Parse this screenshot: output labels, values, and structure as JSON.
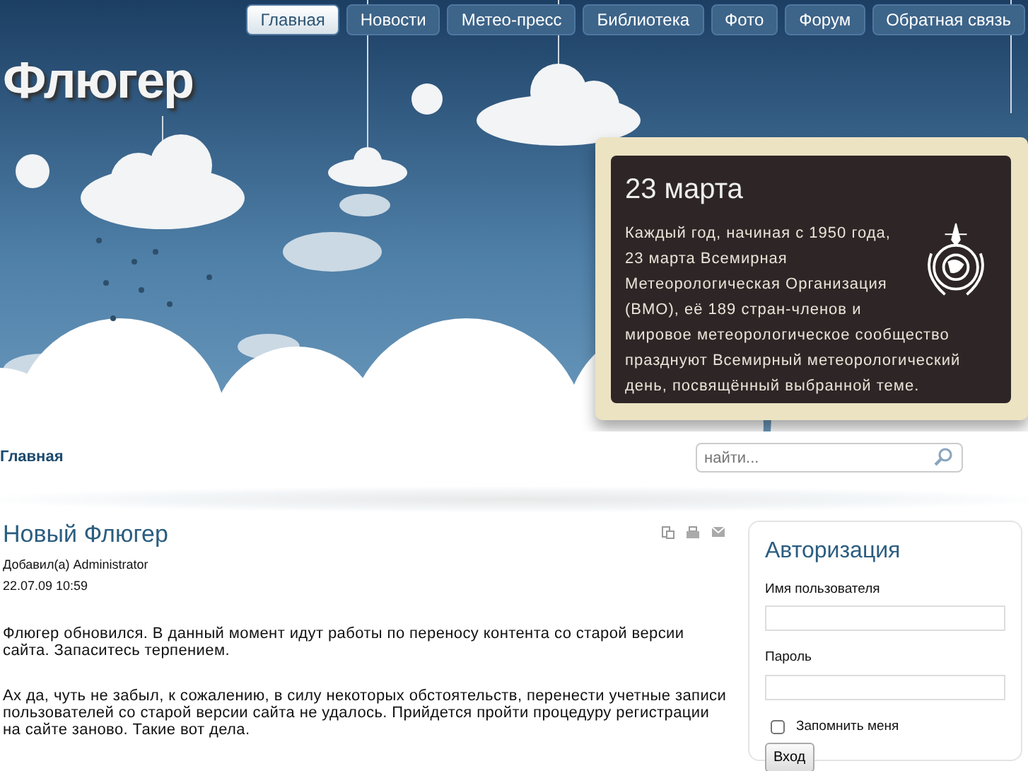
{
  "nav": [
    {
      "label": "Главная",
      "selected": true
    },
    {
      "label": "Новости",
      "selected": false
    },
    {
      "label": "Метео-пресс",
      "selected": false
    },
    {
      "label": "Библиотека",
      "selected": false
    },
    {
      "label": "Фото",
      "selected": false
    },
    {
      "label": "Форум",
      "selected": false
    },
    {
      "label": "Обратная связь",
      "selected": false
    }
  ],
  "logo": "Флюгер",
  "notice": {
    "title": "23 марта",
    "text": "Каждый год, начиная с 1950 года, 23 марта Всемирная Метеорологическая Организация (ВМО), её 189 стран-членов и мировое метеорологическое сообщество празднуют Всемирный метеорологический день, посвящённый выбранной теме."
  },
  "breadcrumb": "Главная",
  "search": {
    "placeholder": "найти..."
  },
  "article": {
    "title": "Новый Флюгер",
    "author": "Добавил(а) Administrator",
    "date": "22.07.09 10:59",
    "paragraphs": [
      "Флюгер обновился. В данный момент идут работы по переносу контента со старой версии сайта. Запаситесь терпением.",
      "Ах да, чуть не забыл, к сожалению, в силу некоторых обстоятельств, перенести учетные записи пользователей со старой версии сайта не удалось. Прийдется пройти процедуру регистрации на сайте заново. Такие вот дела."
    ]
  },
  "login": {
    "title": "Авторизация",
    "username_label": "Имя пользователя",
    "password_label": "Пароль",
    "remember": {
      "label": "Запомнить меня",
      "checked": false
    },
    "button": "Вход"
  }
}
